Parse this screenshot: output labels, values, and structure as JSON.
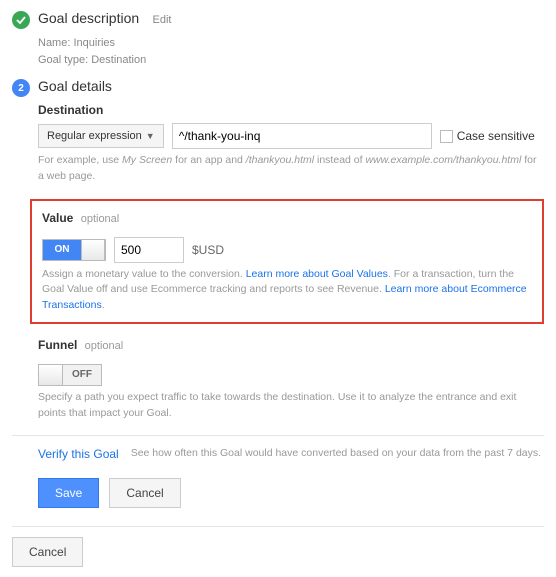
{
  "step1": {
    "title": "Goal description",
    "edit": "Edit",
    "name_label": "Name:",
    "name_value": "Inquiries",
    "type_label": "Goal type:",
    "type_value": "Destination"
  },
  "step2": {
    "number": "2",
    "title": "Goal details"
  },
  "destination": {
    "label": "Destination",
    "match_type": "Regular expression",
    "value": "^/thank-you-inq",
    "case_sensitive": "Case sensitive",
    "help_prefix": "For example, use ",
    "help_em1": "My Screen",
    "help_mid1": " for an app and ",
    "help_em2": "/thankyou.html",
    "help_mid2": " instead of ",
    "help_em3": "www.example.com/thankyou.html",
    "help_suffix": " for a web page."
  },
  "value": {
    "label": "Value",
    "optional": "optional",
    "toggle_on": "ON",
    "amount": "500",
    "currency": "$USD",
    "help_a": "Assign a monetary value to the conversion. ",
    "link1": "Learn more about Goal Values",
    "help_b": ". For a transaction, turn the Goal Value off and use Ecommerce tracking and reports to see Revenue. ",
    "link2": "Learn more about Ecommerce Transactions",
    "help_c": "."
  },
  "funnel": {
    "label": "Funnel",
    "optional": "optional",
    "toggle_off": "OFF",
    "help": "Specify a path you expect traffic to take towards the destination. Use it to analyze the entrance and exit points that impact your Goal."
  },
  "verify": {
    "link": "Verify this Goal",
    "text": "See how often this Goal would have converted based on your data from the past 7 days."
  },
  "buttons": {
    "save": "Save",
    "cancel": "Cancel",
    "footer_cancel": "Cancel"
  }
}
